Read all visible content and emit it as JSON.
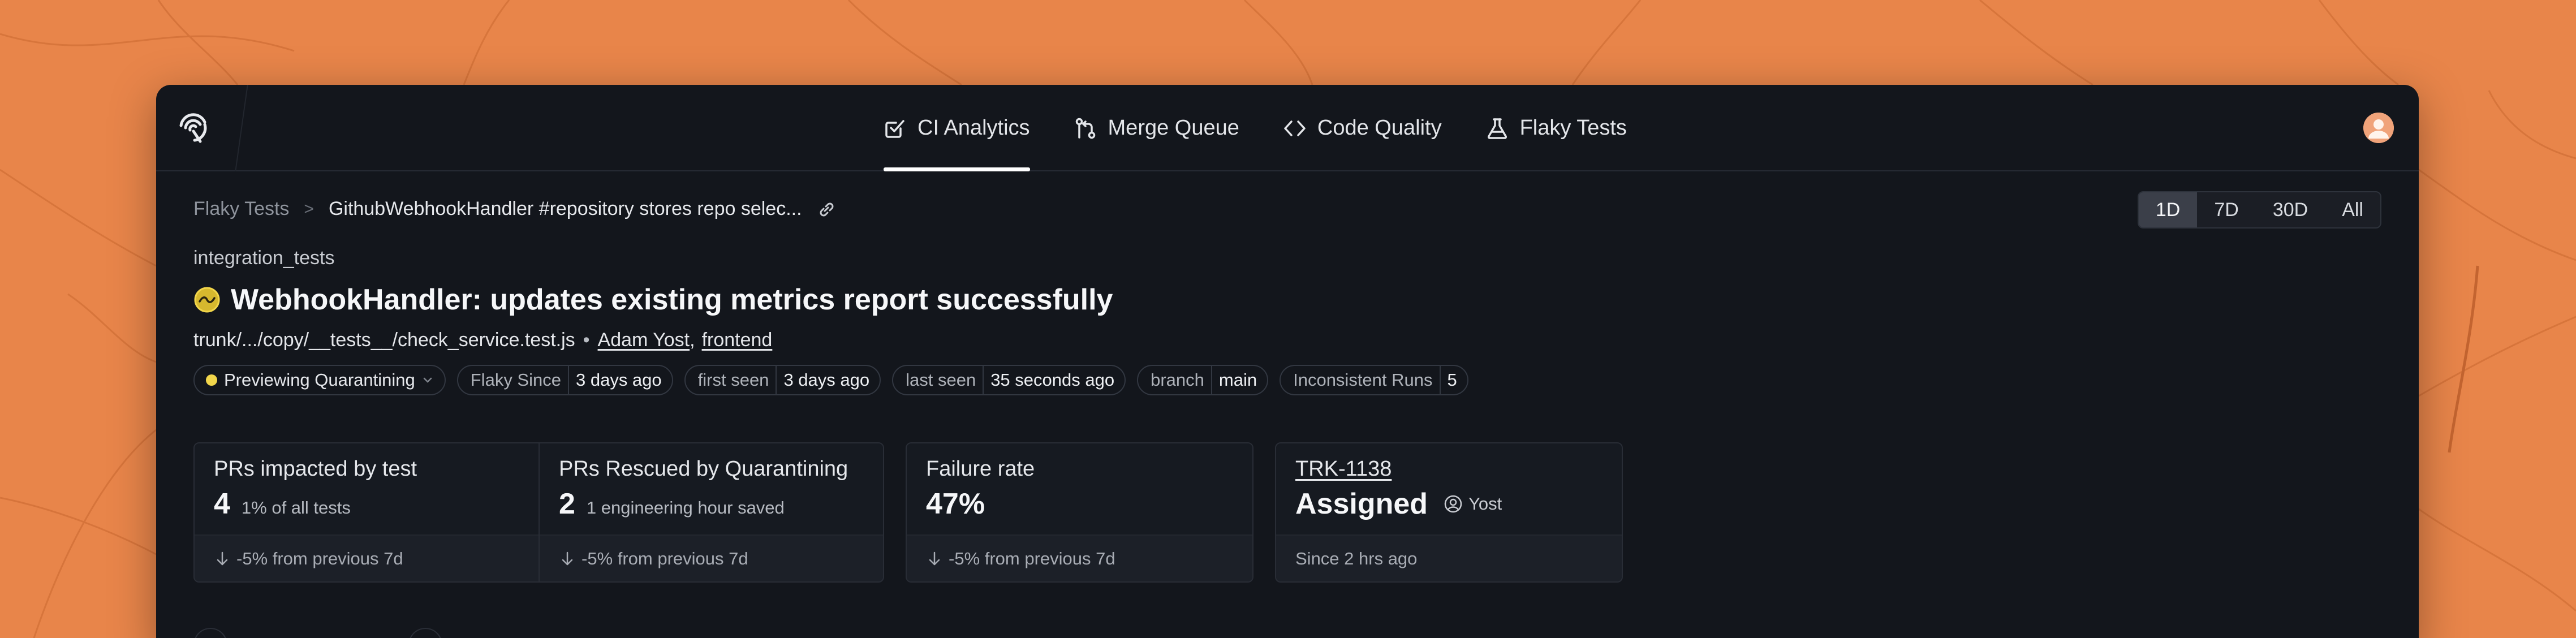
{
  "colors": {
    "background": "#e8854a",
    "window": "#13161c",
    "status_yellow": "#f2d64b",
    "avatar": "#f0a37a"
  },
  "nav": {
    "logo_icon": "trunk-logo-icon",
    "tabs": [
      {
        "label": "CI Analytics",
        "icon": "checkbox-icon",
        "active": true
      },
      {
        "label": "Merge Queue",
        "icon": "git-merge-icon",
        "active": false
      },
      {
        "label": "Code Quality",
        "icon": "code-icon",
        "active": false
      },
      {
        "label": "Flaky Tests",
        "icon": "flask-icon",
        "active": false
      }
    ],
    "avatar_icon": "user-avatar"
  },
  "breadcrumb": {
    "root": "Flaky Tests",
    "separator": ">",
    "current": "GithubWebhookHandler #repository stores repo selec..."
  },
  "range": {
    "options": [
      "1D",
      "7D",
      "30D",
      "All"
    ],
    "selected": "1D"
  },
  "test": {
    "suite": "integration_tests",
    "title": "WebhookHandler: updates existing metrics report successfully",
    "path": "trunk/.../copy/__tests__/check_service.test.js",
    "dot": "•",
    "owner": "Adam Yost",
    "comma": ",",
    "team": "frontend"
  },
  "chips": {
    "status": "Previewing Quarantining",
    "items": [
      {
        "label": "Flaky Since",
        "value": "3 days ago"
      },
      {
        "label": "first seen",
        "value": "3 days ago"
      },
      {
        "label": "last seen",
        "value": "35 seconds ago"
      },
      {
        "label": "branch",
        "value": "main"
      },
      {
        "label": "Inconsistent Runs",
        "value": "5"
      }
    ]
  },
  "stats": {
    "prs_impacted": {
      "label": "PRs impacted by test",
      "value": "4",
      "sub": "1% of all tests",
      "footer": "-5% from previous 7d"
    },
    "prs_rescued": {
      "label": "PRs Rescued by Quarantining",
      "value": "2",
      "sub": "1 engineering hour saved",
      "footer": "-5% from previous 7d"
    },
    "failure_rate": {
      "label": "Failure rate",
      "value": "47%",
      "footer": "-5% from previous 7d"
    },
    "ticket": {
      "label": "TRK-1138",
      "value": "Assigned",
      "assignee": "Yost",
      "footer": "Since 2 hrs ago"
    }
  }
}
